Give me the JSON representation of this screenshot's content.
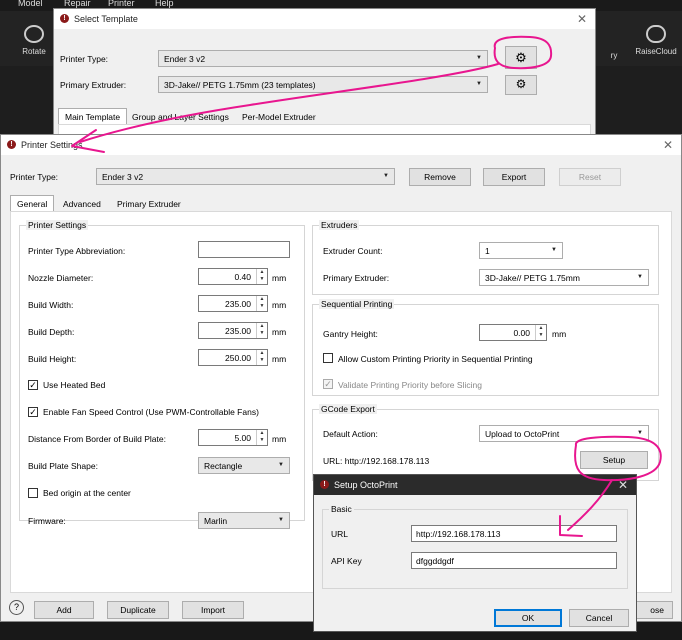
{
  "app": {
    "menu": [
      "Model",
      "Repair",
      "Printer",
      "Help"
    ],
    "toolbar": [
      {
        "label": "Rotate",
        "icon": "rotate-icon"
      },
      {
        "label": "ry",
        "icon": "gallery-icon"
      },
      {
        "label": "RaiseCloud",
        "icon": "cloud-icon"
      }
    ]
  },
  "select_template": {
    "title": "Select Template",
    "printer_type_label": "Printer Type:",
    "printer_type_value": "Ender 3 v2",
    "primary_extruder_label": "Primary Extruder:",
    "primary_extruder_value": "3D-Jake// PETG 1.75mm (23 templates)",
    "tabs": [
      "Main Template",
      "Group and Layer Settings",
      "Per-Model Extruder"
    ]
  },
  "printer_settings": {
    "title": "Printer Settings",
    "printer_type_label": "Printer Type:",
    "printer_type_value": "Ender 3 v2",
    "remove_label": "Remove",
    "export_label": "Export",
    "reset_label": "Reset",
    "tabs": [
      "General",
      "Advanced",
      "Primary Extruder"
    ],
    "printer_group": {
      "title": "Printer Settings",
      "abbrev_label": "Printer Type Abbreviation:",
      "abbrev_value": "",
      "nozzle_label": "Nozzle Diameter:",
      "nozzle_value": "0.40",
      "build_width_label": "Build Width:",
      "build_width_value": "235.00",
      "build_depth_label": "Build Depth:",
      "build_depth_value": "235.00",
      "build_height_label": "Build Height:",
      "build_height_value": "250.00",
      "unit": "mm",
      "heated_bed_label": "Use Heated Bed",
      "fan_speed_label": "Enable Fan Speed Control (Use PWM-Controllable Fans)",
      "distance_label": "Distance From Border of Build Plate:",
      "distance_value": "5.00",
      "plate_shape_label": "Build Plate Shape:",
      "plate_shape_value": "Rectangle",
      "bed_origin_label": "Bed origin at the center",
      "firmware_label": "Firmware:",
      "firmware_value": "Marlin"
    },
    "extruders_group": {
      "title": "Extruders",
      "count_label": "Extruder Count:",
      "count_value": "1",
      "primary_label": "Primary Extruder:",
      "primary_value": "3D-Jake// PETG 1.75mm"
    },
    "sequential_group": {
      "title": "Sequential Printing",
      "gantry_label": "Gantry Height:",
      "gantry_value": "0.00",
      "unit": "mm",
      "custom_priority_label": "Allow Custom Printing Priority in Sequential Printing",
      "validate_label": "Validate Printing Priority before Slicing"
    },
    "gcode_group": {
      "title": "GCode Export",
      "default_action_label": "Default Action:",
      "default_action_value": "Upload to OctoPrint",
      "url_label": "URL: http://192.168.178.113",
      "setup_label": "Setup"
    },
    "bottom": {
      "help_icon": "?",
      "add_label": "Add",
      "duplicate_label": "Duplicate",
      "import_label": "Import",
      "close_label": "ose"
    }
  },
  "octoprint": {
    "title": "Setup OctoPrint",
    "group_title": "Basic",
    "url_label": "URL",
    "url_value": "http://192.168.178.113",
    "api_key_label": "API Key",
    "api_key_value": "dfggddgdf",
    "ok_label": "OK",
    "cancel_label": "Cancel"
  },
  "colors": {
    "annotation": "#e8168f",
    "focus": "#0078d7",
    "app_background": "#1e1e1e"
  }
}
